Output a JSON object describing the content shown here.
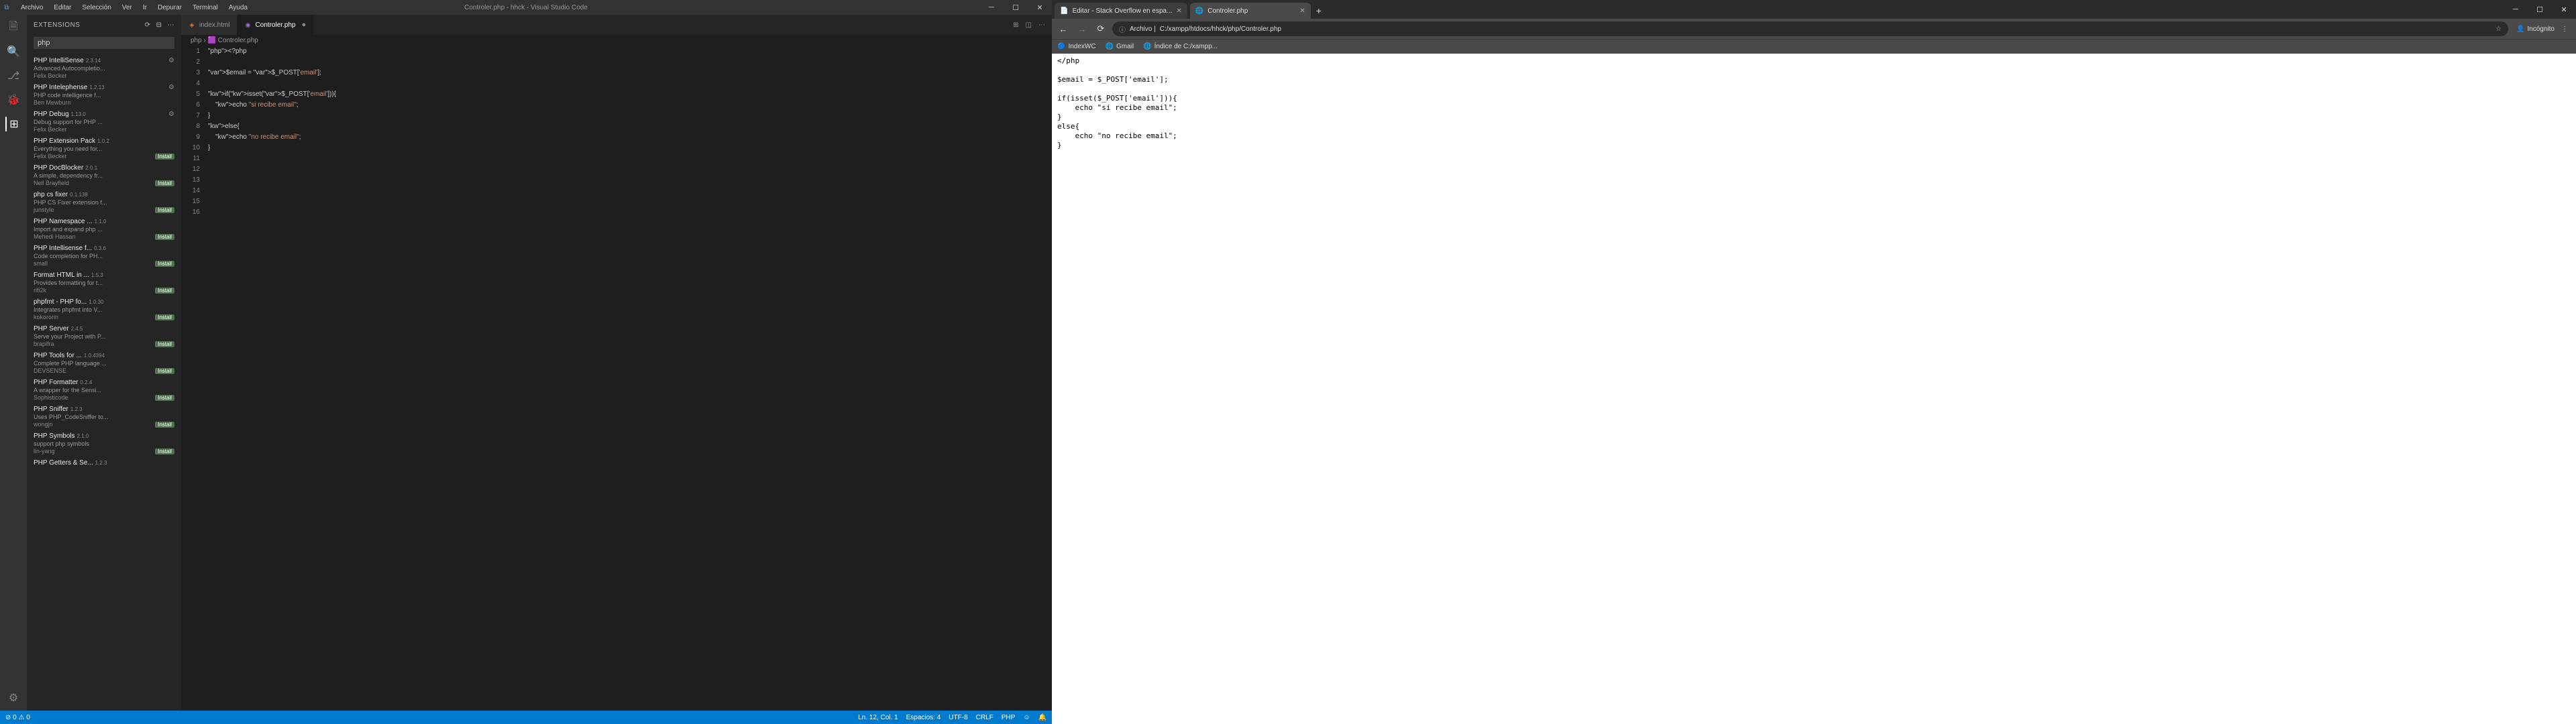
{
  "vscode": {
    "title": "Controler.php - hhck - Visual Studio Code",
    "menu": [
      "Archivo",
      "Editar",
      "Selección",
      "Ver",
      "Ir",
      "Depurar",
      "Terminal",
      "Ayuda"
    ],
    "sidebar": {
      "header": "EXTENSIONS",
      "search": "php",
      "installed_label": "Install",
      "extensions": [
        {
          "name": "PHP IntelliSense",
          "ver": "2.3.14",
          "desc": "Advanced Autocompletio...",
          "author": "Felix Becker",
          "gear": true
        },
        {
          "name": "PHP Intelephense",
          "ver": "1.2.13",
          "desc": "PHP code intelligence f...",
          "author": "Ben Mewburn",
          "gear": true
        },
        {
          "name": "PHP Debug",
          "ver": "1.13.0",
          "desc": "Debug support for PHP ...",
          "author": "Felix Becker",
          "gear": true
        },
        {
          "name": "PHP Extension Pack",
          "ver": "1.0.2",
          "desc": "Everything you need for...",
          "author": "Felix Becker",
          "badge": "Install"
        },
        {
          "name": "PHP DocBlocker",
          "ver": "2.0.1",
          "desc": "A simple, dependency fr...",
          "author": "Neil Brayfield",
          "badge": "Install"
        },
        {
          "name": "php cs fixer",
          "ver": "0.1.138",
          "desc": "PHP CS Fixer extension f...",
          "author": "junstyle",
          "badge": "Install"
        },
        {
          "name": "PHP Namespace ...",
          "ver": "1.1.0",
          "desc": "Import and expand php ...",
          "author": "Mehedi Hassan",
          "badge": "Install"
        },
        {
          "name": "PHP Intellisense f...",
          "ver": "0.3.6",
          "desc": "Code completion for PH...",
          "author": "small",
          "badge": "Install"
        },
        {
          "name": "Format HTML in ...",
          "ver": "1.5.3",
          "desc": "Provides formatting for t...",
          "author": "rifi2k",
          "badge": "Install"
        },
        {
          "name": "phpfmt - PHP fo...",
          "ver": "1.0.30",
          "desc": "Integrates phpfmt into V...",
          "author": "kokororin",
          "badge": "Install"
        },
        {
          "name": "PHP Server",
          "ver": "2.4.5",
          "desc": "Serve your Project with P...",
          "author": "brapifra",
          "badge": "Install"
        },
        {
          "name": "PHP Tools for ...",
          "ver": "1.0.4394",
          "desc": "Complete PHP language ...",
          "author": "DEVSENSE",
          "badge": "Install"
        },
        {
          "name": "PHP Formatter",
          "ver": "0.2.4",
          "desc": "A wrapper for the Sensi...",
          "author": "Sophisticode",
          "badge": "Install"
        },
        {
          "name": "PHP Sniffer",
          "ver": "1.2.3",
          "desc": "Uses PHP_CodeSniffer to...",
          "author": "wongjn",
          "badge": "Install"
        },
        {
          "name": "PHP Symbols",
          "ver": "2.1.0",
          "desc": "support php symbols",
          "author": "lin-yang",
          "badge": "Install"
        },
        {
          "name": "PHP Getters & Se...",
          "ver": "1.2.3",
          "desc": "",
          "author": ""
        }
      ]
    },
    "tabs": [
      {
        "label": "index.html",
        "icon": "html",
        "active": false
      },
      {
        "label": "Controler.php",
        "icon": "php",
        "active": true
      }
    ],
    "breadcrumb": "php › 🟪 Controler.php",
    "code": {
      "lines": [
        "<?php",
        "",
        "$email = $_POST['email'];",
        "",
        "if(isset($_POST['email'])){",
        "    echo \"si recibe email\";",
        "}",
        "else{",
        "    echo \"no recibe email\";",
        "}",
        "",
        "",
        "",
        "",
        "",
        ""
      ]
    },
    "status": {
      "left_icons": "⊘ 0 ⚠ 0",
      "pos": "Ln. 12, Col. 1",
      "spaces": "Espacios: 4",
      "enc": "UTF-8",
      "eol": "CRLF",
      "lang": "PHP",
      "feedback": "☺",
      "bell": "🔔"
    }
  },
  "browser": {
    "tabs": [
      {
        "title": "Editar - Stack Overflow en espa...",
        "active": false,
        "favicon": "📄"
      },
      {
        "title": "Controler.php",
        "active": true,
        "favicon": "🌐"
      }
    ],
    "address": "C:/xampp/htdocs/hhck/php/Controler.php",
    "addr_prefix": "Archivo |",
    "incognito": "Incógnito",
    "bookmarks": [
      {
        "icon": "🔵",
        "label": "IndexWC"
      },
      {
        "icon": "🌐",
        "label": "Gmail"
      },
      {
        "icon": "🌐",
        "label": "Índice de C:/xampp..."
      }
    ],
    "page_output": "</php\n\n$email = $_POST['email'];\n\nif(isset($_POST['email'])){\n    echo \"si recibe email\";\n}\nelse{\n    echo \"no recibe email\";\n}"
  }
}
